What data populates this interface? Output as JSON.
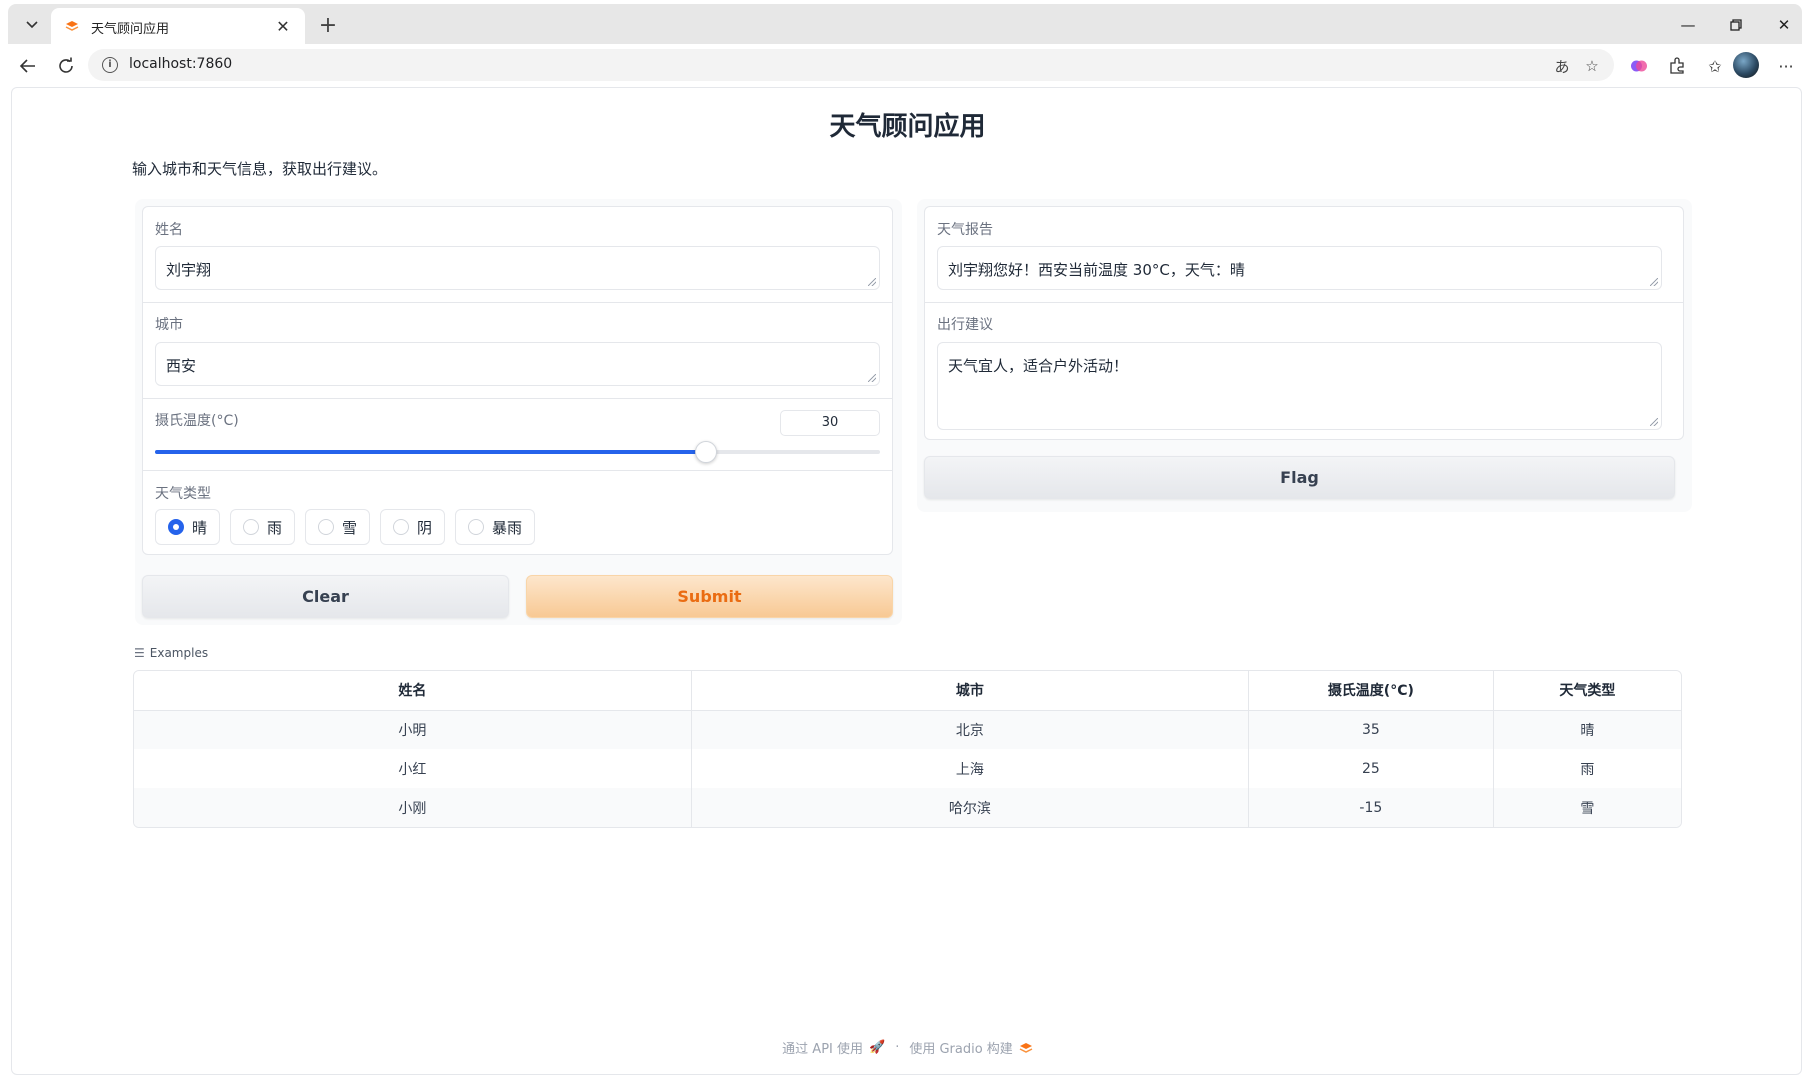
{
  "browser": {
    "tab_title": "天气顾问应用",
    "url": "localhost:7860"
  },
  "app": {
    "title": "天气顾问应用",
    "description": "输入城市和天气信息，获取出行建议。"
  },
  "inputs": {
    "name_label": "姓名",
    "name_value": "刘宇翔",
    "city_label": "城市",
    "city_value": "西安",
    "temp_label": "摄氏温度(°C)",
    "temp_value": "30",
    "temp_fraction": 0.76,
    "weather_label": "天气类型",
    "weather_options": [
      "晴",
      "雨",
      "雪",
      "阴",
      "暴雨"
    ],
    "weather_selected": "晴"
  },
  "actions": {
    "clear_label": "Clear",
    "submit_label": "Submit",
    "flag_label": "Flag"
  },
  "outputs": {
    "report_label": "天气报告",
    "report_value": "刘宇翔您好！西安当前温度 30°C，天气：晴",
    "advice_label": "出行建议",
    "advice_value": "天气宜人，适合户外活动！"
  },
  "examples": {
    "label": "Examples",
    "headers": [
      "姓名",
      "城市",
      "摄氏温度(°C)",
      "天气类型"
    ],
    "rows": [
      [
        "小明",
        "北京",
        "35",
        "晴"
      ],
      [
        "小红",
        "上海",
        "25",
        "雨"
      ],
      [
        "小刚",
        "哈尔滨",
        "-15",
        "雪"
      ]
    ]
  },
  "footer": {
    "api_text": "通过 API 使用",
    "separator": "·",
    "built_text": "使用 Gradio 构建"
  },
  "colors": {
    "accent_blue": "#2563eb",
    "submit_text": "#ea6c12",
    "submit_bg": "#f8c994",
    "gradio_orange": "#f97316"
  }
}
